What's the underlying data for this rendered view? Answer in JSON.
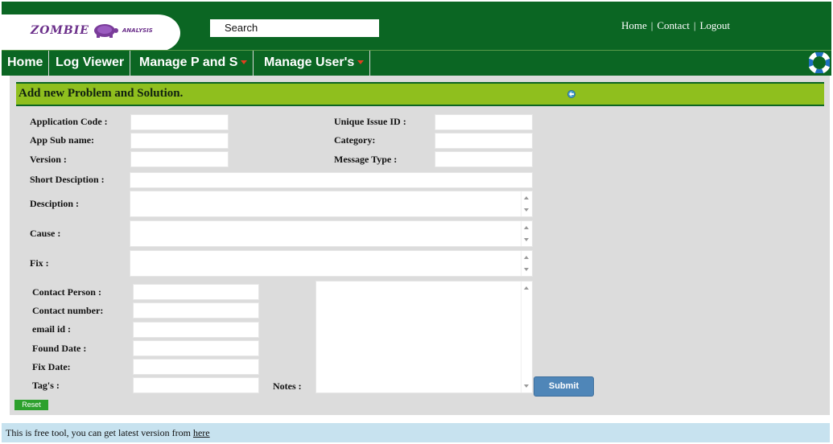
{
  "header": {
    "logo_text": "ZOMBIE",
    "logo_subtext": "ANALYSIS",
    "search_value": "Search",
    "links": [
      "Home",
      "Contact",
      "Logout"
    ]
  },
  "nav": {
    "items": [
      {
        "label": "Home"
      },
      {
        "label": "Log Viewer"
      },
      {
        "label": "Manage P and S"
      },
      {
        "label": "Manage User's"
      }
    ]
  },
  "form": {
    "title": "Add new Problem and Solution.",
    "application_code_label": "Application Code :",
    "unique_issue_id_label": "Unique Issue ID :",
    "app_sub_name_label": "App Sub name:",
    "category_label": "Category:",
    "version_label": "Version :",
    "message_type_label": "Message Type :",
    "short_description_label": "Short Desciption :",
    "description_label": "Desciption :",
    "cause_label": "Cause :",
    "fix_label": "Fix :",
    "contact_person_label": "Contact Person :",
    "contact_number_label": "Contact number:",
    "email_label": "email id :",
    "found_date_label": "Found Date :",
    "fix_date_label": "Fix Date:",
    "tags_label": "Tag's :",
    "notes_label": "Notes :",
    "submit_label": "Submit",
    "reset_label": "Reset"
  },
  "footer": {
    "text": "This is free tool, you can get latest version from ",
    "link": "here"
  },
  "colors": {
    "header_green": "#0b6623",
    "section_bar": "#8fbf1e",
    "content_bg": "#dcdcdc",
    "submit_blue": "#4f86b8",
    "reset_green": "#2ca02c",
    "footer_bg": "#c7e2ef"
  },
  "icons": [
    "turtle-logo-icon",
    "lifebuoy-help-icon",
    "refresh-icon",
    "dropdown-arrow-icon"
  ]
}
